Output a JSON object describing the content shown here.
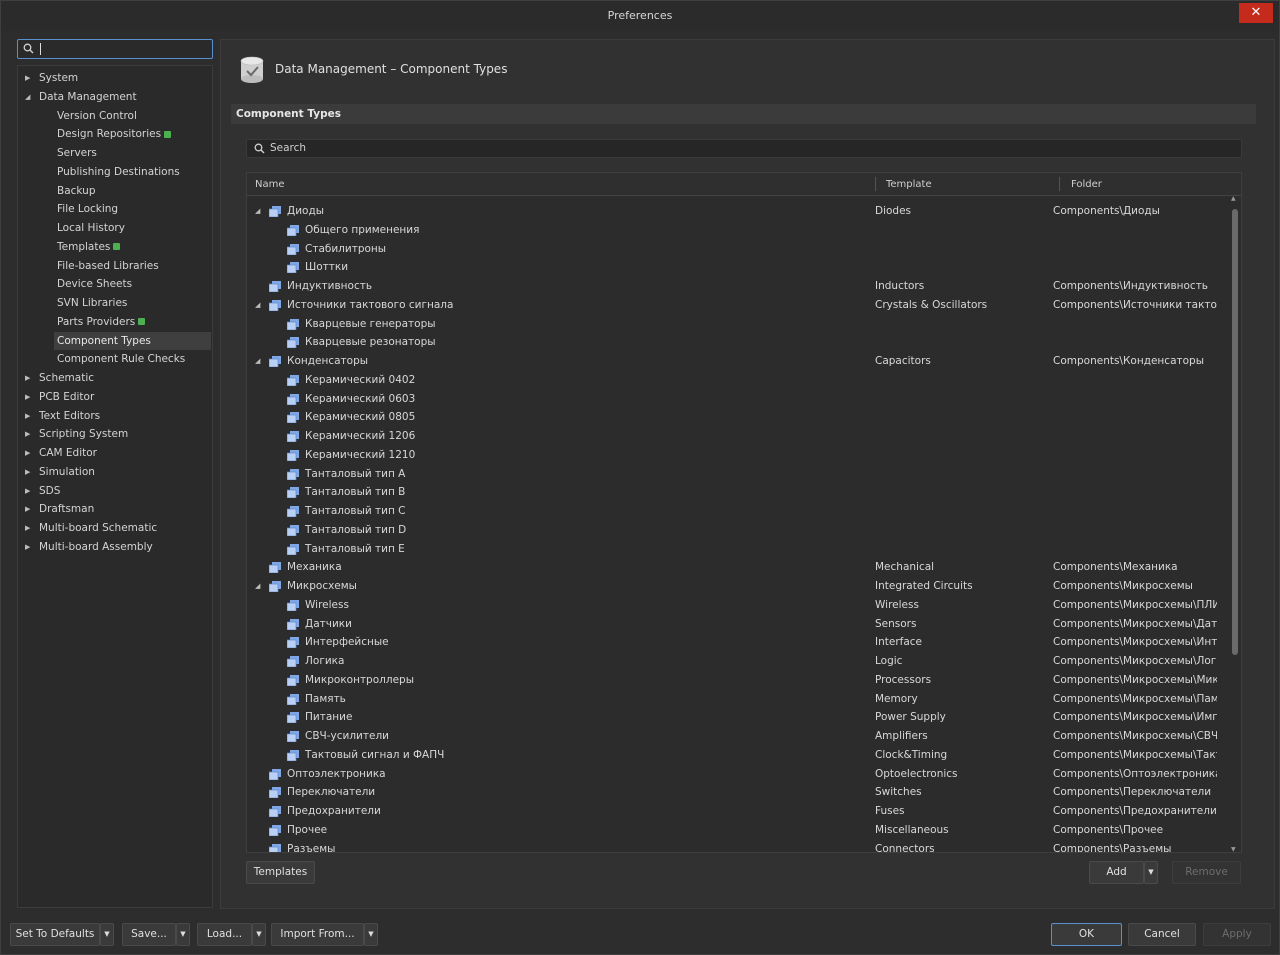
{
  "window": {
    "title": "Preferences",
    "close_label": "✕"
  },
  "sidebar": {
    "search_placeholder": "",
    "items": [
      {
        "label": "System",
        "expanded": false,
        "level": 0
      },
      {
        "label": "Data Management",
        "expanded": true,
        "level": 0
      },
      {
        "label": "Version Control",
        "level": 1
      },
      {
        "label": "Design Repositories",
        "level": 1,
        "ext": true
      },
      {
        "label": "Servers",
        "level": 1
      },
      {
        "label": "Publishing Destinations",
        "level": 1
      },
      {
        "label": "Backup",
        "level": 1
      },
      {
        "label": "File Locking",
        "level": 1
      },
      {
        "label": "Local History",
        "level": 1
      },
      {
        "label": "Templates",
        "level": 1,
        "ext": true
      },
      {
        "label": "File-based Libraries",
        "level": 1
      },
      {
        "label": "Device Sheets",
        "level": 1
      },
      {
        "label": "SVN Libraries",
        "level": 1
      },
      {
        "label": "Parts Providers",
        "level": 1,
        "ext": true
      },
      {
        "label": "Component Types",
        "level": 1,
        "selected": true
      },
      {
        "label": "Component Rule Checks",
        "level": 1
      },
      {
        "label": "Schematic",
        "expanded": false,
        "level": 0
      },
      {
        "label": "PCB Editor",
        "expanded": false,
        "level": 0
      },
      {
        "label": "Text Editors",
        "expanded": false,
        "level": 0
      },
      {
        "label": "Scripting System",
        "expanded": false,
        "level": 0
      },
      {
        "label": "CAM Editor",
        "expanded": false,
        "level": 0
      },
      {
        "label": "Simulation",
        "expanded": false,
        "level": 0
      },
      {
        "label": "SDS",
        "expanded": false,
        "level": 0
      },
      {
        "label": "Draftsman",
        "expanded": false,
        "level": 0
      },
      {
        "label": "Multi-board Schematic",
        "expanded": false,
        "level": 0
      },
      {
        "label": "Multi-board Assembly",
        "expanded": false,
        "level": 0
      }
    ]
  },
  "main": {
    "page_title": "Data Management – Component Types",
    "section_title": "Component Types",
    "search_placeholder": "Search",
    "columns": {
      "name": "Name",
      "template": "Template",
      "folder": "Folder"
    },
    "rows": [
      {
        "name": "Диоды",
        "level": 0,
        "expandable": true,
        "template": "Diodes",
        "folder": "Components\\Диоды"
      },
      {
        "name": "Общего применения",
        "level": 1,
        "template": "",
        "folder": ""
      },
      {
        "name": "Стабилитроны",
        "level": 1,
        "template": "",
        "folder": ""
      },
      {
        "name": "Шоттки",
        "level": 1,
        "template": "",
        "folder": ""
      },
      {
        "name": "Индуктивность",
        "level": 0,
        "expandable": false,
        "template": "Inductors",
        "folder": "Components\\Индуктивность"
      },
      {
        "name": "Источники тактового сигнала",
        "level": 0,
        "expandable": true,
        "template": "Crystals & Oscillators",
        "folder": "Components\\Источники тактово"
      },
      {
        "name": "Кварцевые генераторы",
        "level": 1,
        "template": "",
        "folder": ""
      },
      {
        "name": "Кварцевые резонаторы",
        "level": 1,
        "template": "",
        "folder": ""
      },
      {
        "name": "Конденсаторы",
        "level": 0,
        "expandable": true,
        "template": "Capacitors",
        "folder": "Components\\Конденсаторы"
      },
      {
        "name": "Керамический 0402",
        "level": 1,
        "template": "",
        "folder": ""
      },
      {
        "name": "Керамический 0603",
        "level": 1,
        "template": "",
        "folder": ""
      },
      {
        "name": "Керамический 0805",
        "level": 1,
        "template": "",
        "folder": ""
      },
      {
        "name": "Керамический 1206",
        "level": 1,
        "template": "",
        "folder": ""
      },
      {
        "name": "Керамический 1210",
        "level": 1,
        "template": "",
        "folder": ""
      },
      {
        "name": "Танталовый тип A",
        "level": 1,
        "template": "",
        "folder": ""
      },
      {
        "name": "Танталовый тип B",
        "level": 1,
        "template": "",
        "folder": ""
      },
      {
        "name": "Танталовый тип C",
        "level": 1,
        "template": "",
        "folder": ""
      },
      {
        "name": "Танталовый тип D",
        "level": 1,
        "template": "",
        "folder": ""
      },
      {
        "name": "Танталовый тип E",
        "level": 1,
        "template": "",
        "folder": ""
      },
      {
        "name": "Механика",
        "level": 0,
        "expandable": false,
        "template": "Mechanical",
        "folder": "Components\\Механика"
      },
      {
        "name": "Микросхемы",
        "level": 0,
        "expandable": true,
        "template": "Integrated Circuits",
        "folder": "Components\\Микросхемы"
      },
      {
        "name": "Wireless",
        "level": 1,
        "template": "Wireless",
        "folder": "Components\\Микросхемы\\ПЛИС"
      },
      {
        "name": "Датчики",
        "level": 1,
        "template": "Sensors",
        "folder": "Components\\Микросхемы\\Датчи"
      },
      {
        "name": "Интерфейсные",
        "level": 1,
        "template": "Interface",
        "folder": "Components\\Микросхемы\\Интер"
      },
      {
        "name": "Логика",
        "level": 1,
        "template": "Logic",
        "folder": "Components\\Микросхемы\\Логик"
      },
      {
        "name": "Микроконтроллеры",
        "level": 1,
        "template": "Processors",
        "folder": "Components\\Микросхемы\\Микр"
      },
      {
        "name": "Память",
        "level": 1,
        "template": "Memory",
        "folder": "Components\\Микросхемы\\Памят"
      },
      {
        "name": "Питание",
        "level": 1,
        "template": "Power Supply",
        "folder": "Components\\Микросхемы\\Импул"
      },
      {
        "name": "СВЧ-усилители",
        "level": 1,
        "template": "Amplifiers",
        "folder": "Components\\Микросхемы\\СВЧ-у"
      },
      {
        "name": "Тактовый сигнал и ФАПЧ",
        "level": 1,
        "template": "Clock&Timing",
        "folder": "Components\\Микросхемы\\Такто"
      },
      {
        "name": "Оптоэлектроника",
        "level": 0,
        "expandable": false,
        "template": "Optoelectronics",
        "folder": "Components\\Оптоэлектроника"
      },
      {
        "name": "Переключатели",
        "level": 0,
        "expandable": false,
        "template": "Switches",
        "folder": "Components\\Переключатели"
      },
      {
        "name": "Предохранители",
        "level": 0,
        "expandable": false,
        "template": "Fuses",
        "folder": "Components\\Предохранители"
      },
      {
        "name": "Прочее",
        "level": 0,
        "expandable": false,
        "template": "Miscellaneous",
        "folder": "Components\\Прочее"
      },
      {
        "name": "Разъемы",
        "level": 0,
        "expandable": false,
        "template": "Connectors",
        "folder": "Components\\Разъемы"
      }
    ],
    "buttons": {
      "templates": "Templates",
      "add": "Add",
      "remove": "Remove"
    }
  },
  "footer": {
    "set_to_defaults": "Set To Defaults",
    "save": "Save...",
    "load": "Load...",
    "import_from": "Import From...",
    "ok": "OK",
    "cancel": "Cancel",
    "apply": "Apply"
  },
  "colors": {
    "accent": "#5a8fd0",
    "close": "#c42b1c",
    "ext_badge": "#4caf50",
    "type_icon": "#7fa7e6"
  }
}
